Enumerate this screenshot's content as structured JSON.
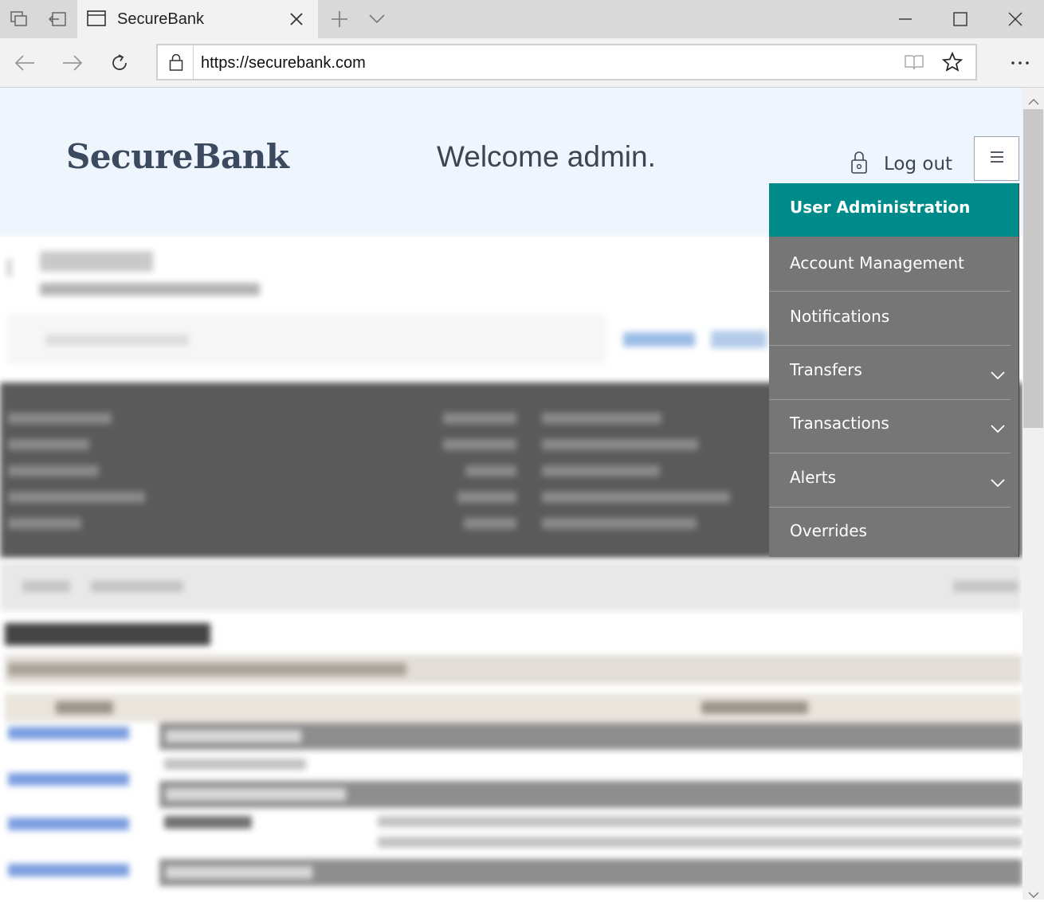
{
  "browser": {
    "tab_title": "SecureBank",
    "url": "https://securebank.com"
  },
  "site": {
    "brand": "SecureBank",
    "welcome": "Welcome admin.",
    "logout_label": "Log out"
  },
  "menu": {
    "items": [
      {
        "label": "User Administration",
        "active": true,
        "expandable": false
      },
      {
        "label": "Account Management",
        "active": false,
        "expandable": false
      },
      {
        "label": "Notifications",
        "active": false,
        "expandable": false
      },
      {
        "label": "Transfers",
        "active": false,
        "expandable": true
      },
      {
        "label": "Transactions",
        "active": false,
        "expandable": true
      },
      {
        "label": "Alerts",
        "active": false,
        "expandable": true
      },
      {
        "label": "Overrides",
        "active": false,
        "expandable": false
      }
    ]
  },
  "colors": {
    "menu_active": "#008b8b",
    "menu_bg": "#767676",
    "header_bg": "#eef5fc"
  }
}
